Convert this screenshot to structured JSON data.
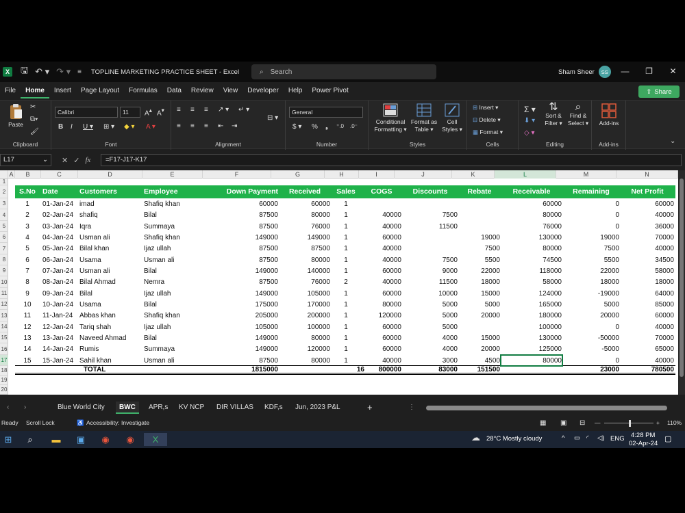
{
  "titlebar": {
    "app_icon": "X",
    "title": "TOPLINE  MARKETING PRACTICE SHEET  -  Excel",
    "search_placeholder": "Search",
    "user_name": "Sham Sheer",
    "user_initials": "SS"
  },
  "tabs": [
    "File",
    "Home",
    "Insert",
    "Page Layout",
    "Formulas",
    "Data",
    "Review",
    "View",
    "Developer",
    "Help",
    "Power Pivot"
  ],
  "share_label": "Share",
  "ribbon": {
    "paste": "Paste",
    "clipboard": "Clipboard",
    "font_name": "Calibri",
    "font_size": "11",
    "font": "Font",
    "alignment": "Alignment",
    "number_format": "General",
    "number": "Number",
    "conditional_formatting": [
      "Conditional",
      "Formatting ▾"
    ],
    "format_as_table": [
      "Format as",
      "Table ▾"
    ],
    "cell_styles": [
      "Cell",
      "Styles ▾"
    ],
    "styles": "Styles",
    "insert": "Insert",
    "delete": "Delete",
    "format": "Format",
    "cells": "Cells",
    "sort_filter": [
      "Sort &",
      "Filter ▾"
    ],
    "find_select": [
      "Find &",
      "Select ▾"
    ],
    "editing": "Editing",
    "addins_btn": "Add-ins",
    "addins": "Add-ins"
  },
  "formula_bar": {
    "name_box": "L17",
    "formula": "=F17-J17-K17"
  },
  "columns": [
    "A",
    "B",
    "C",
    "D",
    "E",
    "F",
    "G",
    "H",
    "I",
    "J",
    "K",
    "L",
    "M",
    "N"
  ],
  "rows": [
    "1",
    "2",
    "3",
    "4",
    "5",
    "6",
    "7",
    "8",
    "9",
    "10",
    "11",
    "12",
    "13",
    "14",
    "15",
    "16",
    "17",
    "18",
    "19",
    "20"
  ],
  "table": {
    "headers": [
      "S.No",
      "Date",
      "Customers",
      "Employee",
      "Down Payment",
      "Received",
      "Sales",
      "COGS",
      "Discounts",
      "Rebate",
      "Receivable",
      "Remaining",
      "Net Profit"
    ],
    "rows": [
      [
        "1",
        "01-Jan-24",
        "imad",
        "Shafiq khan",
        "60000",
        "60000",
        "1",
        "",
        "",
        "",
        "60000",
        "0",
        "60000"
      ],
      [
        "2",
        "02-Jan-24",
        "shafiq",
        "Bilal",
        "87500",
        "80000",
        "1",
        "40000",
        "7500",
        "",
        "80000",
        "0",
        "40000"
      ],
      [
        "3",
        "03-Jan-24",
        "Iqra",
        "Summaya",
        "87500",
        "76000",
        "1",
        "40000",
        "11500",
        "",
        "76000",
        "0",
        "36000"
      ],
      [
        "4",
        "04-Jan-24",
        "Usman ali",
        "Shafiq khan",
        "149000",
        "149000",
        "1",
        "60000",
        "",
        "19000",
        "130000",
        "19000",
        "70000"
      ],
      [
        "5",
        "05-Jan-24",
        "Bilal khan",
        "Ijaz ullah",
        "87500",
        "87500",
        "1",
        "40000",
        "",
        "7500",
        "80000",
        "7500",
        "40000"
      ],
      [
        "6",
        "06-Jan-24",
        "Usama",
        "Usman ali",
        "87500",
        "80000",
        "1",
        "40000",
        "7500",
        "5500",
        "74500",
        "5500",
        "34500"
      ],
      [
        "7",
        "07-Jan-24",
        "Usman ali",
        "Bilal",
        "149000",
        "140000",
        "1",
        "60000",
        "9000",
        "22000",
        "118000",
        "22000",
        "58000"
      ],
      [
        "8",
        "08-Jan-24",
        "Bilal Ahmad",
        "Nemra",
        "87500",
        "76000",
        "2",
        "40000",
        "11500",
        "18000",
        "58000",
        "18000",
        "18000"
      ],
      [
        "9",
        "09-Jan-24",
        "Bilal",
        "Ijaz ullah",
        "149000",
        "105000",
        "1",
        "60000",
        "10000",
        "15000",
        "124000",
        "-19000",
        "64000"
      ],
      [
        "10",
        "10-Jan-24",
        "Usama",
        "Bilal",
        "175000",
        "170000",
        "1",
        "80000",
        "5000",
        "5000",
        "165000",
        "5000",
        "85000"
      ],
      [
        "11",
        "11-Jan-24",
        "Abbas khan",
        "Shafiq khan",
        "205000",
        "200000",
        "1",
        "120000",
        "5000",
        "20000",
        "180000",
        "20000",
        "60000"
      ],
      [
        "12",
        "12-Jan-24",
        "Tariq shah",
        "Ijaz ullah",
        "105000",
        "100000",
        "1",
        "60000",
        "5000",
        "",
        "100000",
        "0",
        "40000"
      ],
      [
        "13",
        "13-Jan-24",
        "Naveed Ahmad",
        "Bilal",
        "149000",
        "80000",
        "1",
        "60000",
        "4000",
        "15000",
        "130000",
        "-50000",
        "70000"
      ],
      [
        "14",
        "14-Jan-24",
        "Rumis",
        "Summaya",
        "149000",
        "120000",
        "1",
        "60000",
        "4000",
        "20000",
        "125000",
        "-5000",
        "65000"
      ],
      [
        "15",
        "15-Jan-24",
        "Sahil khan",
        "Usman ali",
        "87500",
        "80000",
        "1",
        "40000",
        "3000",
        "4500",
        "80000",
        "0",
        "40000"
      ]
    ],
    "total": {
      "label": "TOTAL",
      "down_payment": "1815000",
      "sales": "16",
      "cogs": "800000",
      "discounts": "83000",
      "rebate": "151500",
      "remaining": "23000",
      "net_profit": "780500"
    }
  },
  "sheets": [
    "Blue World City",
    "BWC",
    "APR,s",
    "KV NCP",
    "DIR VILLAS",
    "KDF,s",
    "Jun, 2023 P&L"
  ],
  "active_sheet": "BWC",
  "status": {
    "ready": "Ready",
    "scroll_lock": "Scroll Lock",
    "accessibility": "Accessibility: Investigate",
    "zoom": "110%"
  },
  "taskbar": {
    "weather": "28°C  Mostly cloudy",
    "lang": "ENG",
    "time": "4:28 PM",
    "date": "02-Apr-24"
  },
  "colors": {
    "header_green": "#1fb24a",
    "excel_green": "#107c41"
  }
}
